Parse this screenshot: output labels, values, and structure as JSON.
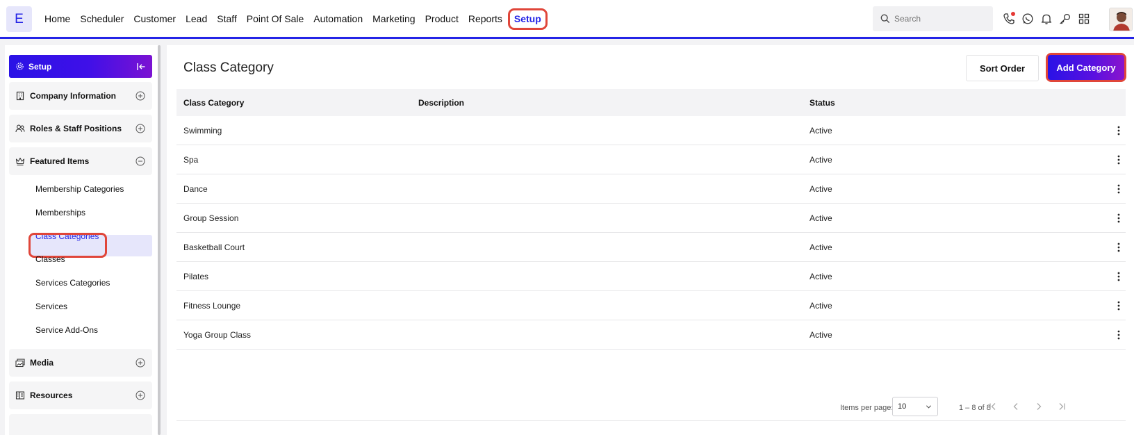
{
  "app": {
    "logo_letter": "E",
    "accent": "#2424e6",
    "highlight": "#e0463a"
  },
  "nav": {
    "items": [
      "Home",
      "Scheduler",
      "Customer",
      "Lead",
      "Staff",
      "Point Of Sale",
      "Automation",
      "Marketing",
      "Product",
      "Reports",
      "Setup"
    ],
    "active": "Setup"
  },
  "search": {
    "placeholder": "Search"
  },
  "top_icons": [
    "phone-icon",
    "whatsapp-icon",
    "bell-icon",
    "key-icon",
    "grid-icon"
  ],
  "sidebar": {
    "header": "Setup",
    "sections": [
      {
        "label": "Company Information",
        "icon": "building-icon",
        "expanded": false
      },
      {
        "label": "Roles & Staff Positions",
        "icon": "users-icon",
        "expanded": false
      },
      {
        "label": "Featured Items",
        "icon": "crown-icon",
        "expanded": true
      },
      {
        "label": "Media",
        "icon": "media-icon",
        "expanded": false
      },
      {
        "label": "Resources",
        "icon": "resources-icon",
        "expanded": false
      }
    ],
    "featured_items": [
      "Membership Categories",
      "Memberships",
      "Class Categories",
      "Classes",
      "Services Categories",
      "Services",
      "Service Add-Ons"
    ],
    "active_item": "Class Categories"
  },
  "main": {
    "title": "Class Category",
    "sort_button": "Sort Order",
    "add_button": "Add Category",
    "columns": [
      "Class Category",
      "Description",
      "Status"
    ],
    "rows": [
      {
        "name": "Swimming",
        "description": "",
        "status": "Active"
      },
      {
        "name": "Spa",
        "description": "",
        "status": "Active"
      },
      {
        "name": "Dance",
        "description": "",
        "status": "Active"
      },
      {
        "name": "Group Session",
        "description": "",
        "status": "Active"
      },
      {
        "name": "Basketball Court",
        "description": "",
        "status": "Active"
      },
      {
        "name": "Pilates",
        "description": "",
        "status": "Active"
      },
      {
        "name": "Fitness Lounge",
        "description": "",
        "status": "Active"
      },
      {
        "name": "Yoga Group Class",
        "description": "",
        "status": "Active"
      }
    ],
    "pagination": {
      "items_per_page_label": "Items per page:",
      "items_per_page": "10",
      "range": "1 – 8 of 8"
    }
  }
}
